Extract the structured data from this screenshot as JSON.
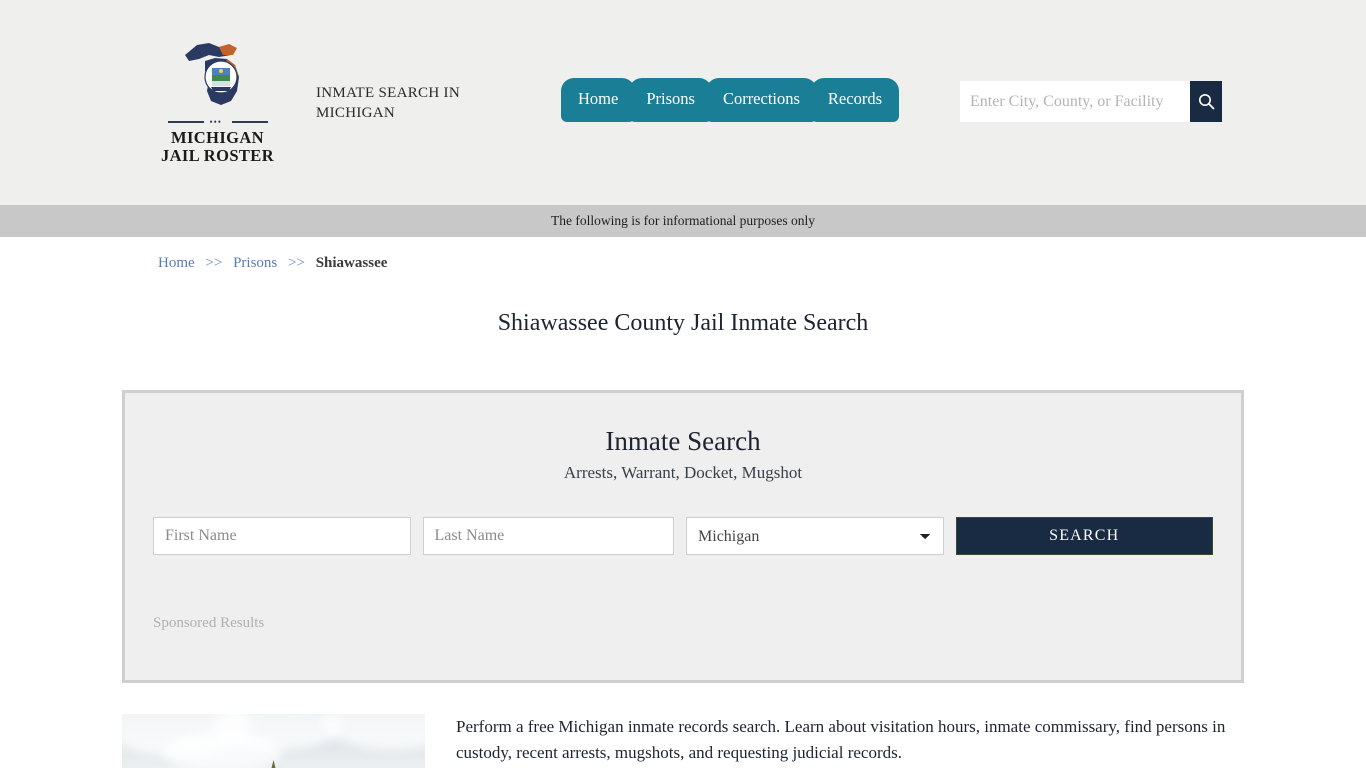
{
  "header": {
    "logo": {
      "line1": "MICHIGAN",
      "line2": "JAIL ROSTER",
      "icon": "michigan-state-seal-icon"
    },
    "tagline": "INMATE SEARCH IN MICHIGAN",
    "nav_items": [
      {
        "label": "Home"
      },
      {
        "label": "Prisons"
      },
      {
        "label": "Corrections"
      },
      {
        "label": "Records"
      }
    ],
    "search": {
      "placeholder": "Enter City, County, or Facility",
      "value": "",
      "button_icon": "search-icon"
    }
  },
  "infobar": {
    "text": "The following is for informational purposes only"
  },
  "breadcrumb": {
    "items": [
      {
        "label": "Home",
        "current": false
      },
      {
        "label": "Prisons",
        "current": false
      },
      {
        "label": "Shiawassee",
        "current": true
      }
    ],
    "separator": ">>"
  },
  "page": {
    "title": "Shiawassee County Jail Inmate Search"
  },
  "search_panel": {
    "heading": "Inmate Search",
    "subheading": "Arrests, Warrant, Docket, Mugshot",
    "first_name": {
      "placeholder": "First Name",
      "value": ""
    },
    "last_name": {
      "placeholder": "Last Name",
      "value": ""
    },
    "state": {
      "selected": "Michigan",
      "options": [
        "Michigan"
      ]
    },
    "search_button": "SEARCH",
    "sponsored_label": "Sponsored Results"
  },
  "article": {
    "body": "Perform a free Michigan inmate records search. Learn about visitation hours, inmate commissary, find persons in custody, recent arrests, mugshots, and requesting judicial records.",
    "photo_alt": "county-jail-photo"
  },
  "colors": {
    "teal": "#1a7f96",
    "navy": "#182b42",
    "header_bg": "#efefed",
    "infobar_bg": "#c8c8c8",
    "panel_bg": "#efefef",
    "link_blue": "#5b7bb4"
  }
}
